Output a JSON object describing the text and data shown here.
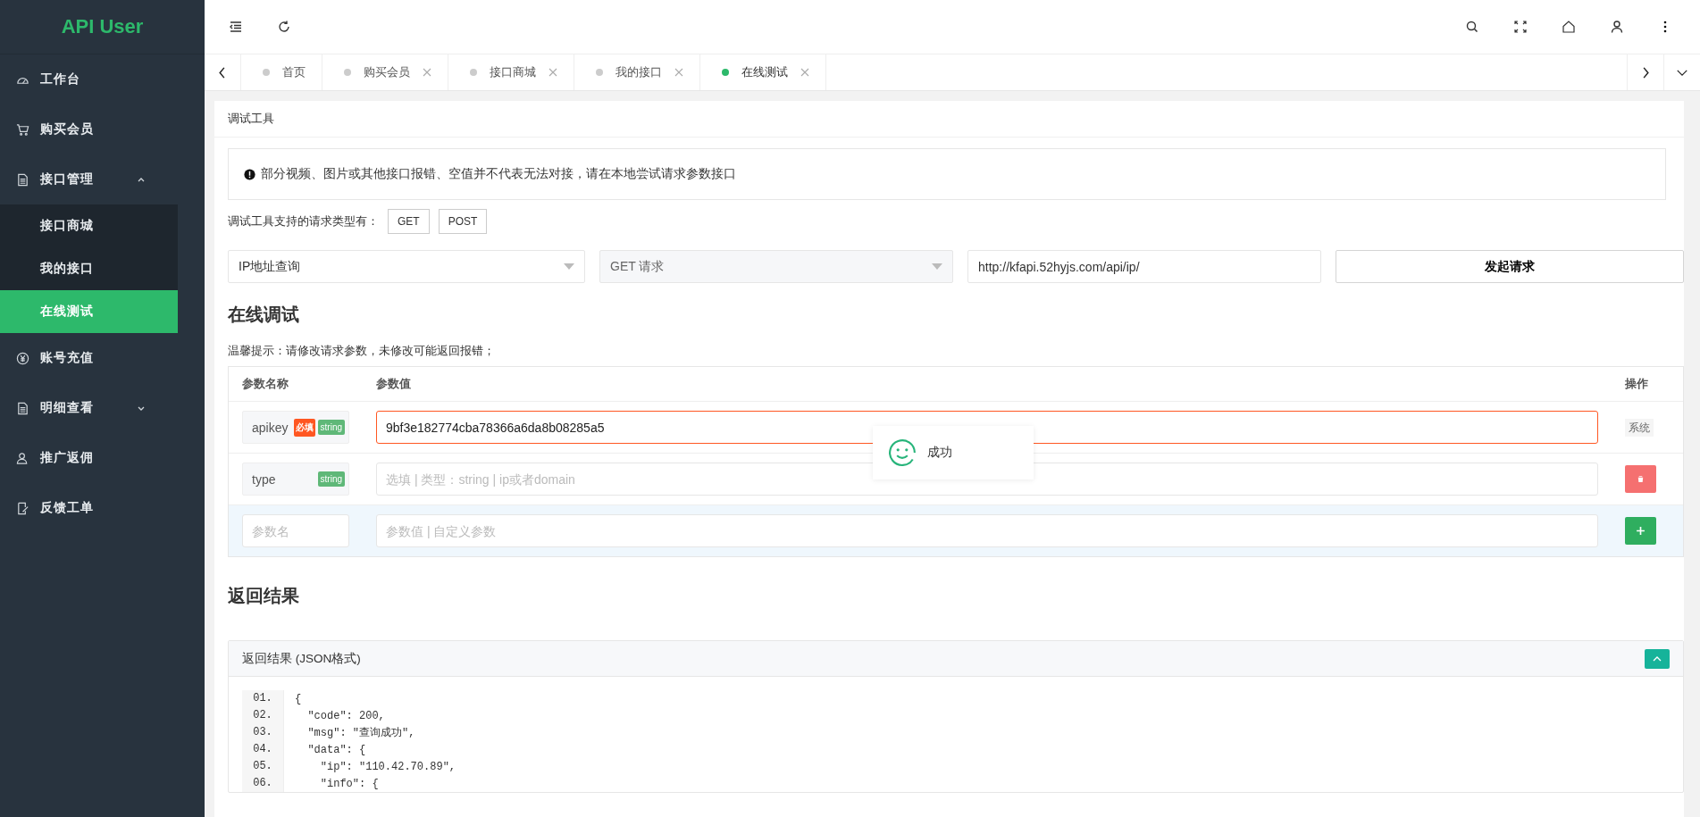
{
  "sidebar": {
    "logo": "API User",
    "items": [
      {
        "label": "工作台"
      },
      {
        "label": "购买会员"
      },
      {
        "label": "接口管理",
        "expanded": true,
        "children": [
          {
            "label": "接口商城",
            "selected": false
          },
          {
            "label": "我的接口",
            "selected": false
          },
          {
            "label": "在线测试",
            "selected": true
          }
        ]
      },
      {
        "label": "账号充值"
      },
      {
        "label": "明细查看",
        "expanded": false
      },
      {
        "label": "推广返佣"
      },
      {
        "label": "反馈工单"
      }
    ]
  },
  "tabs": [
    {
      "label": "首页",
      "selected": false,
      "closable": false
    },
    {
      "label": "购买会员",
      "selected": false,
      "closable": true
    },
    {
      "label": "接口商城",
      "selected": false,
      "closable": true
    },
    {
      "label": "我的接口",
      "selected": false,
      "closable": true
    },
    {
      "label": "在线测试",
      "selected": true,
      "closable": true
    }
  ],
  "card": {
    "title": "调试工具",
    "alert": "部分视频、图片或其他接口报错、空值并不代表无法对接，请在本地尝试请求参数接口",
    "methods_label": "调试工具支持的请求类型有：",
    "methods": [
      "GET",
      "POST"
    ],
    "api_select": "IP地址查询",
    "method_select": "GET 请求",
    "url": "http://kfapi.52hyjs.com/api/ip/",
    "submit": "发起请求",
    "section_title": "在线调试",
    "hint": "温馨提示：请修改请求参数，未修改可能返回报错；",
    "params": {
      "columns": [
        "参数名称",
        "参数值",
        "操作"
      ],
      "rows": [
        {
          "kind": "system",
          "name": "apikey",
          "required": true,
          "required_tag": "必填",
          "type": "string",
          "value": "9bf3e182774cba78366a6da8b08285a5",
          "action": "系统"
        },
        {
          "kind": "optional",
          "name": "type",
          "required": false,
          "type": "string",
          "placeholder": "选填 | 类型：string | ip或者domain"
        },
        {
          "kind": "new",
          "name_placeholder": "参数名",
          "placeholder": "参数值 | 自定义参数"
        }
      ]
    },
    "result_title": "返回结果",
    "result_panel": "返回结果 (JSON格式)",
    "code": [
      {
        "no": "01.",
        "text": "{"
      },
      {
        "no": "02.",
        "text": "  \"code\": 200,"
      },
      {
        "no": "03.",
        "text": "  \"msg\": \"查询成功\","
      },
      {
        "no": "04.",
        "text": "  \"data\": {"
      },
      {
        "no": "05.",
        "text": "    \"ip\": \"110.42.70.89\","
      },
      {
        "no": "06.",
        "text": "    \"info\": {"
      }
    ]
  },
  "toast": {
    "text": "成功"
  }
}
